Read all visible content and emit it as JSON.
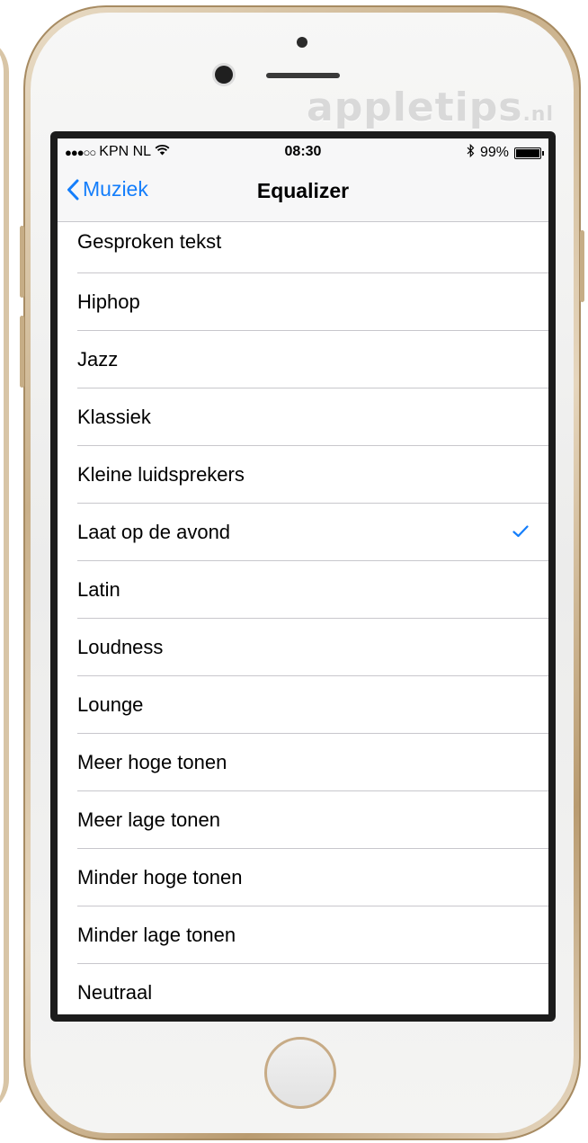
{
  "watermark": {
    "brand": "appletips",
    "suffix": ".nl"
  },
  "status_bar": {
    "signal": "●●●○○",
    "carrier": "KPN NL",
    "wifi_icon": "wifi-icon",
    "time": "08:30",
    "bluetooth_icon": "bluetooth-icon",
    "battery_percent": "99%",
    "battery_level": 0.99
  },
  "nav": {
    "back_label": "Muziek",
    "title": "Equalizer"
  },
  "colors": {
    "accent": "#147efb",
    "separator": "#c8c7cc"
  },
  "equalizer_options": [
    {
      "label": "Gesproken tekst",
      "selected": false
    },
    {
      "label": "Hiphop",
      "selected": false
    },
    {
      "label": "Jazz",
      "selected": false
    },
    {
      "label": "Klassiek",
      "selected": false
    },
    {
      "label": "Kleine luidsprekers",
      "selected": false
    },
    {
      "label": "Laat op de avond",
      "selected": true
    },
    {
      "label": "Latin",
      "selected": false
    },
    {
      "label": "Loudness",
      "selected": false
    },
    {
      "label": "Lounge",
      "selected": false
    },
    {
      "label": "Meer hoge tonen",
      "selected": false
    },
    {
      "label": "Meer lage tonen",
      "selected": false
    },
    {
      "label": "Minder hoge tonen",
      "selected": false
    },
    {
      "label": "Minder lage tonen",
      "selected": false
    },
    {
      "label": "Neutraal",
      "selected": false
    }
  ]
}
